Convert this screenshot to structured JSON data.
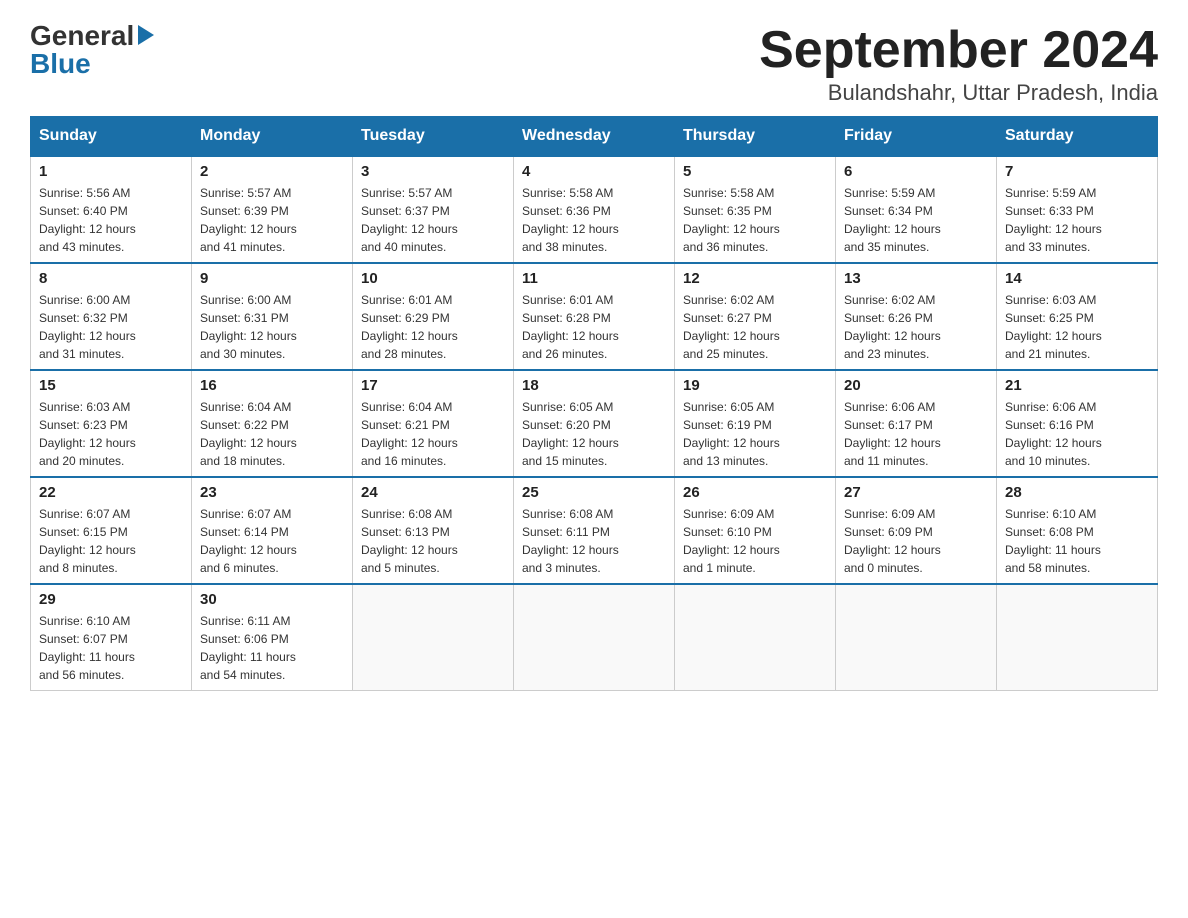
{
  "header": {
    "logo_general": "General",
    "logo_blue": "Blue",
    "month_title": "September 2024",
    "subtitle": "Bulandshahr, Uttar Pradesh, India"
  },
  "days_of_week": [
    "Sunday",
    "Monday",
    "Tuesday",
    "Wednesday",
    "Thursday",
    "Friday",
    "Saturday"
  ],
  "weeks": [
    [
      {
        "day": "1",
        "sunrise": "5:56 AM",
        "sunset": "6:40 PM",
        "daylight": "12 hours and 43 minutes."
      },
      {
        "day": "2",
        "sunrise": "5:57 AM",
        "sunset": "6:39 PM",
        "daylight": "12 hours and 41 minutes."
      },
      {
        "day": "3",
        "sunrise": "5:57 AM",
        "sunset": "6:37 PM",
        "daylight": "12 hours and 40 minutes."
      },
      {
        "day": "4",
        "sunrise": "5:58 AM",
        "sunset": "6:36 PM",
        "daylight": "12 hours and 38 minutes."
      },
      {
        "day": "5",
        "sunrise": "5:58 AM",
        "sunset": "6:35 PM",
        "daylight": "12 hours and 36 minutes."
      },
      {
        "day": "6",
        "sunrise": "5:59 AM",
        "sunset": "6:34 PM",
        "daylight": "12 hours and 35 minutes."
      },
      {
        "day": "7",
        "sunrise": "5:59 AM",
        "sunset": "6:33 PM",
        "daylight": "12 hours and 33 minutes."
      }
    ],
    [
      {
        "day": "8",
        "sunrise": "6:00 AM",
        "sunset": "6:32 PM",
        "daylight": "12 hours and 31 minutes."
      },
      {
        "day": "9",
        "sunrise": "6:00 AM",
        "sunset": "6:31 PM",
        "daylight": "12 hours and 30 minutes."
      },
      {
        "day": "10",
        "sunrise": "6:01 AM",
        "sunset": "6:29 PM",
        "daylight": "12 hours and 28 minutes."
      },
      {
        "day": "11",
        "sunrise": "6:01 AM",
        "sunset": "6:28 PM",
        "daylight": "12 hours and 26 minutes."
      },
      {
        "day": "12",
        "sunrise": "6:02 AM",
        "sunset": "6:27 PM",
        "daylight": "12 hours and 25 minutes."
      },
      {
        "day": "13",
        "sunrise": "6:02 AM",
        "sunset": "6:26 PM",
        "daylight": "12 hours and 23 minutes."
      },
      {
        "day": "14",
        "sunrise": "6:03 AM",
        "sunset": "6:25 PM",
        "daylight": "12 hours and 21 minutes."
      }
    ],
    [
      {
        "day": "15",
        "sunrise": "6:03 AM",
        "sunset": "6:23 PM",
        "daylight": "12 hours and 20 minutes."
      },
      {
        "day": "16",
        "sunrise": "6:04 AM",
        "sunset": "6:22 PM",
        "daylight": "12 hours and 18 minutes."
      },
      {
        "day": "17",
        "sunrise": "6:04 AM",
        "sunset": "6:21 PM",
        "daylight": "12 hours and 16 minutes."
      },
      {
        "day": "18",
        "sunrise": "6:05 AM",
        "sunset": "6:20 PM",
        "daylight": "12 hours and 15 minutes."
      },
      {
        "day": "19",
        "sunrise": "6:05 AM",
        "sunset": "6:19 PM",
        "daylight": "12 hours and 13 minutes."
      },
      {
        "day": "20",
        "sunrise": "6:06 AM",
        "sunset": "6:17 PM",
        "daylight": "12 hours and 11 minutes."
      },
      {
        "day": "21",
        "sunrise": "6:06 AM",
        "sunset": "6:16 PM",
        "daylight": "12 hours and 10 minutes."
      }
    ],
    [
      {
        "day": "22",
        "sunrise": "6:07 AM",
        "sunset": "6:15 PM",
        "daylight": "12 hours and 8 minutes."
      },
      {
        "day": "23",
        "sunrise": "6:07 AM",
        "sunset": "6:14 PM",
        "daylight": "12 hours and 6 minutes."
      },
      {
        "day": "24",
        "sunrise": "6:08 AM",
        "sunset": "6:13 PM",
        "daylight": "12 hours and 5 minutes."
      },
      {
        "day": "25",
        "sunrise": "6:08 AM",
        "sunset": "6:11 PM",
        "daylight": "12 hours and 3 minutes."
      },
      {
        "day": "26",
        "sunrise": "6:09 AM",
        "sunset": "6:10 PM",
        "daylight": "12 hours and 1 minute."
      },
      {
        "day": "27",
        "sunrise": "6:09 AM",
        "sunset": "6:09 PM",
        "daylight": "12 hours and 0 minutes."
      },
      {
        "day": "28",
        "sunrise": "6:10 AM",
        "sunset": "6:08 PM",
        "daylight": "11 hours and 58 minutes."
      }
    ],
    [
      {
        "day": "29",
        "sunrise": "6:10 AM",
        "sunset": "6:07 PM",
        "daylight": "11 hours and 56 minutes."
      },
      {
        "day": "30",
        "sunrise": "6:11 AM",
        "sunset": "6:06 PM",
        "daylight": "11 hours and 54 minutes."
      },
      null,
      null,
      null,
      null,
      null
    ]
  ],
  "labels": {
    "sunrise": "Sunrise:",
    "sunset": "Sunset:",
    "daylight": "Daylight:"
  }
}
